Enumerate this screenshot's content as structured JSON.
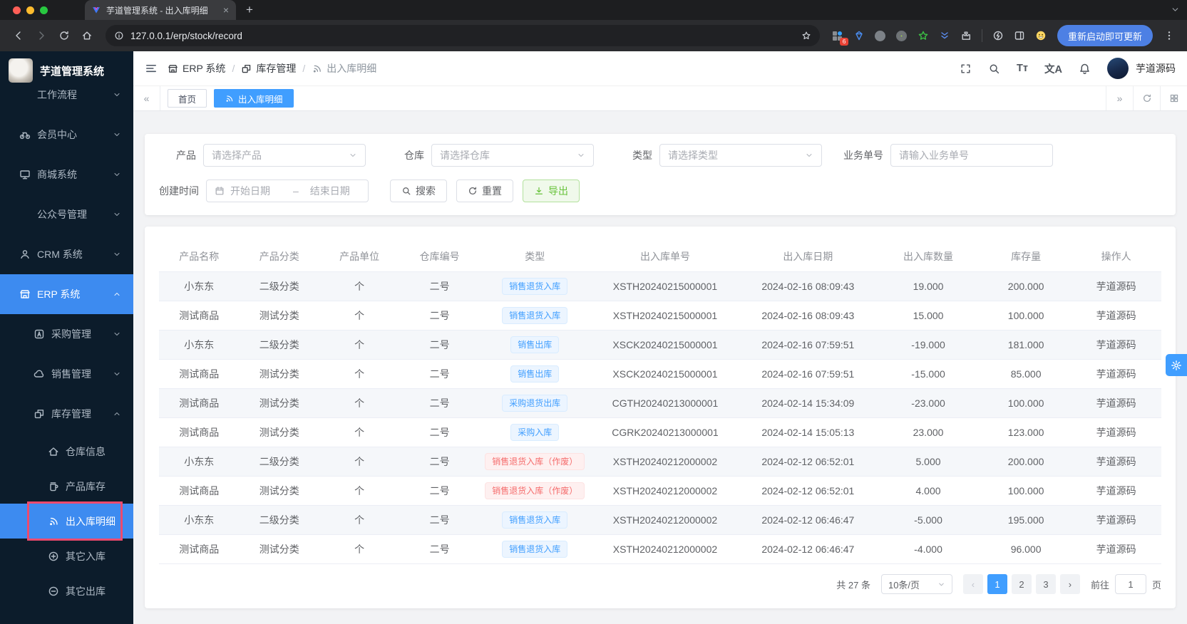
{
  "colors": {
    "accent": "#409eff",
    "sidebar_bg": "#0c1c2b",
    "sidebar_active": "#3d8bf0",
    "success": "#67c23a",
    "danger": "#f56c6c",
    "annotation_box": "#ed4a6e",
    "badge_blue_text": "#409eff",
    "badge_blue_bg": "#ecf5ff",
    "badge_red_text": "#f56c6c",
    "badge_red_bg": "#fef0f0"
  },
  "browser": {
    "tab_title": "芋道管理系统 - 出入库明细",
    "url": "127.0.0.1/erp/stock/record",
    "update_button": "重新启动即可更新",
    "extension_badge": "6"
  },
  "sidebar": {
    "logo_title": "芋道管理系统",
    "menu": [
      {
        "label": "工作流程",
        "level": 1,
        "icon": null,
        "chevron": "down"
      },
      {
        "label": "会员中心",
        "level": 1,
        "icon": "bicycle",
        "chevron": "down"
      },
      {
        "label": "商城系统",
        "level": 1,
        "icon": "monitor",
        "chevron": "down"
      },
      {
        "label": "公众号管理",
        "level": 1,
        "icon": null,
        "chevron": "down"
      },
      {
        "label": "CRM 系统",
        "level": 1,
        "icon": "user",
        "chevron": "down"
      },
      {
        "label": "ERP 系统",
        "level": 1,
        "icon": "shop",
        "chevron": "up",
        "active": true
      },
      {
        "label": "采购管理",
        "level": 2,
        "icon": "purchase",
        "chevron": "down"
      },
      {
        "label": "销售管理",
        "level": 2,
        "icon": "sales",
        "chevron": "down"
      },
      {
        "label": "库存管理",
        "level": 2,
        "icon": "inventory",
        "chevron": "up"
      },
      {
        "label": "仓库信息",
        "level": 3,
        "icon": "house"
      },
      {
        "label": "产品库存",
        "level": 3,
        "icon": "cup"
      },
      {
        "label": "出入库明细",
        "level": 3,
        "icon": "signal",
        "active": true,
        "annotated": true
      },
      {
        "label": "其它入库",
        "level": 3,
        "icon": "plus-circle"
      },
      {
        "label": "其它出库",
        "level": 3,
        "icon": "minus-circle"
      }
    ]
  },
  "header": {
    "breadcrumb": [
      {
        "icon": "shop",
        "label": "ERP 系统"
      },
      {
        "icon": "inventory",
        "label": "库存管理"
      },
      {
        "icon": "signal",
        "label": "出入库明细"
      }
    ],
    "username": "芋道源码"
  },
  "tabbar": {
    "tabs": [
      {
        "label": "首页",
        "active": false,
        "icon": null
      },
      {
        "label": "出入库明细",
        "active": true,
        "icon": "signal"
      }
    ]
  },
  "filters": {
    "product": {
      "label": "产品",
      "placeholder": "请选择产品"
    },
    "warehouse": {
      "label": "仓库",
      "placeholder": "请选择仓库"
    },
    "type": {
      "label": "类型",
      "placeholder": "请选择类型"
    },
    "biz_no": {
      "label": "业务单号",
      "placeholder": "请输入业务单号"
    },
    "create_time": {
      "label": "创建时间",
      "start_placeholder": "开始日期",
      "separator": "–",
      "end_placeholder": "结束日期"
    },
    "buttons": {
      "search": "搜索",
      "reset": "重置",
      "export": "导出"
    }
  },
  "table": {
    "headers": [
      "产品名称",
      "产品分类",
      "产品单位",
      "仓库编号",
      "类型",
      "出入库单号",
      "出入库日期",
      "出入库数量",
      "库存量",
      "操作人"
    ],
    "rows": [
      {
        "name": "小东东",
        "category": "二级分类",
        "unit": "个",
        "warehouse": "二号",
        "type": {
          "text": "销售退货入库",
          "variant": "blue"
        },
        "order_no": "XSTH20240215000001",
        "date": "2024-02-16 08:09:43",
        "quantity": "19.000",
        "stock": "200.000",
        "operator": "芋道源码"
      },
      {
        "name": "测试商品",
        "category": "测试分类",
        "unit": "个",
        "warehouse": "二号",
        "type": {
          "text": "销售退货入库",
          "variant": "blue"
        },
        "order_no": "XSTH20240215000001",
        "date": "2024-02-16 08:09:43",
        "quantity": "15.000",
        "stock": "100.000",
        "operator": "芋道源码"
      },
      {
        "name": "小东东",
        "category": "二级分类",
        "unit": "个",
        "warehouse": "二号",
        "type": {
          "text": "销售出库",
          "variant": "blue"
        },
        "order_no": "XSCK20240215000001",
        "date": "2024-02-16 07:59:51",
        "quantity": "-19.000",
        "stock": "181.000",
        "operator": "芋道源码"
      },
      {
        "name": "测试商品",
        "category": "测试分类",
        "unit": "个",
        "warehouse": "二号",
        "type": {
          "text": "销售出库",
          "variant": "blue"
        },
        "order_no": "XSCK20240215000001",
        "date": "2024-02-16 07:59:51",
        "quantity": "-15.000",
        "stock": "85.000",
        "operator": "芋道源码"
      },
      {
        "name": "测试商品",
        "category": "测试分类",
        "unit": "个",
        "warehouse": "二号",
        "type": {
          "text": "采购退货出库",
          "variant": "blue"
        },
        "order_no": "CGTH20240213000001",
        "date": "2024-02-14 15:34:09",
        "quantity": "-23.000",
        "stock": "100.000",
        "operator": "芋道源码"
      },
      {
        "name": "测试商品",
        "category": "测试分类",
        "unit": "个",
        "warehouse": "二号",
        "type": {
          "text": "采购入库",
          "variant": "blue"
        },
        "order_no": "CGRK20240213000001",
        "date": "2024-02-14 15:05:13",
        "quantity": "23.000",
        "stock": "123.000",
        "operator": "芋道源码"
      },
      {
        "name": "小东东",
        "category": "二级分类",
        "unit": "个",
        "warehouse": "二号",
        "type": {
          "text": "销售退货入库（作废）",
          "variant": "red"
        },
        "order_no": "XSTH20240212000002",
        "date": "2024-02-12 06:52:01",
        "quantity": "5.000",
        "stock": "200.000",
        "operator": "芋道源码"
      },
      {
        "name": "测试商品",
        "category": "测试分类",
        "unit": "个",
        "warehouse": "二号",
        "type": {
          "text": "销售退货入库（作废）",
          "variant": "red"
        },
        "order_no": "XSTH20240212000002",
        "date": "2024-02-12 06:52:01",
        "quantity": "4.000",
        "stock": "100.000",
        "operator": "芋道源码"
      },
      {
        "name": "小东东",
        "category": "二级分类",
        "unit": "个",
        "warehouse": "二号",
        "type": {
          "text": "销售退货入库",
          "variant": "blue"
        },
        "order_no": "XSTH20240212000002",
        "date": "2024-02-12 06:46:47",
        "quantity": "-5.000",
        "stock": "195.000",
        "operator": "芋道源码"
      },
      {
        "name": "测试商品",
        "category": "测试分类",
        "unit": "个",
        "warehouse": "二号",
        "type": {
          "text": "销售退货入库",
          "variant": "blue"
        },
        "order_no": "XSTH20240212000002",
        "date": "2024-02-12 06:46:47",
        "quantity": "-4.000",
        "stock": "96.000",
        "operator": "芋道源码"
      }
    ]
  },
  "pagination": {
    "total": "共 27 条",
    "page_size": "10条/页",
    "pages": [
      "1",
      "2",
      "3"
    ],
    "active_page": "1",
    "goto_label": "前往",
    "goto_value": "1",
    "goto_suffix": "页"
  }
}
